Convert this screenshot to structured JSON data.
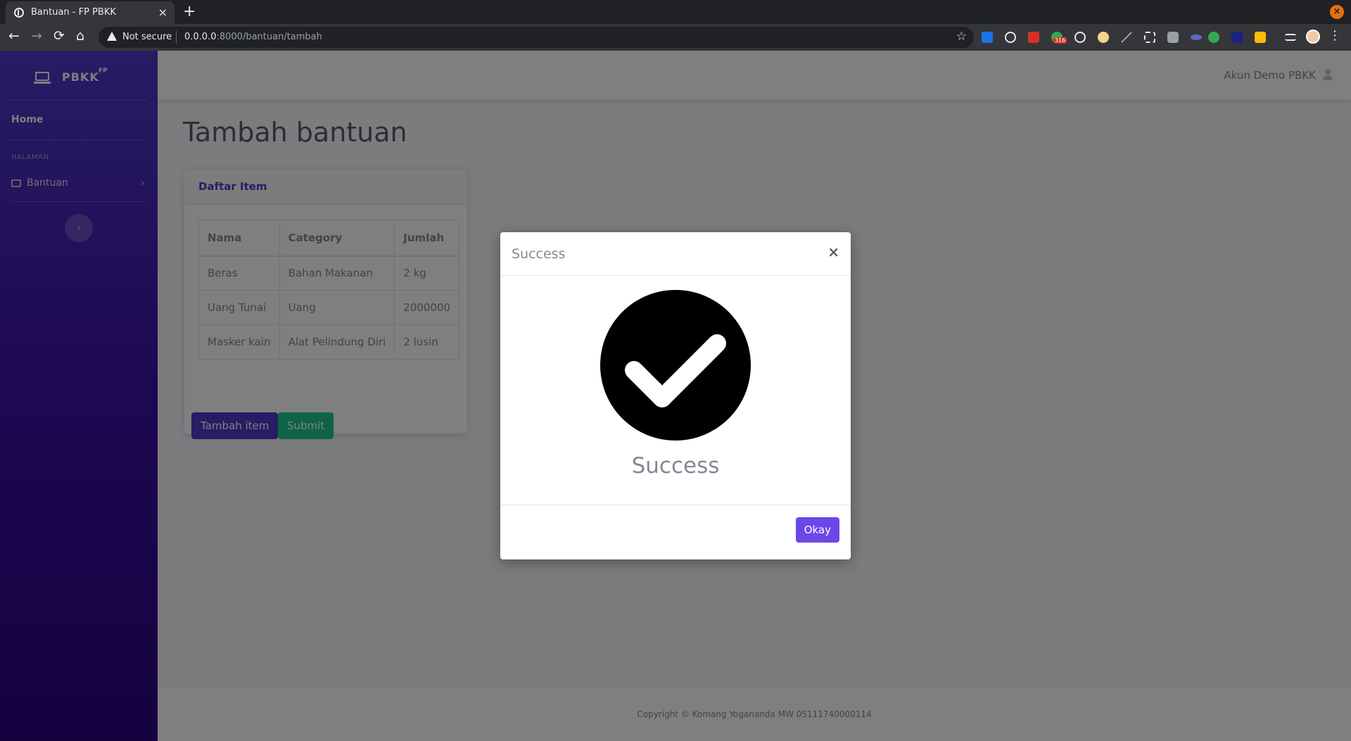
{
  "browser": {
    "tab_title": "Bantuan - FP PBKK",
    "tab_close": "×",
    "new_tab": "+",
    "win_close": "×",
    "security_label": "Not secure",
    "url_host": "0.0.0.0",
    "url_rest": ":8000/bantuan/tambah",
    "ext_badge": "316",
    "nav": {
      "back": "←",
      "forward": "→",
      "reload": "⟳",
      "home": "⌂"
    },
    "star": "☆",
    "menu": "⋮",
    "extension_icons": [
      "s-extension-icon",
      "react-devtools-icon",
      "red-extension-icon",
      "green-chat-icon",
      "globe-icon",
      "cookie-icon",
      "pen-icon",
      "crop-icon",
      "camera-icon",
      "php-icon",
      "color-icon",
      "terminal-icon",
      "note-icon",
      "playlist-icon"
    ]
  },
  "sidebar": {
    "brand": "PBKK",
    "brand_sup": "FP",
    "home": "Home",
    "heading": "HALAMAN",
    "item": "Bantuan",
    "chevron": "›",
    "toggle": "‹"
  },
  "topbar": {
    "user_name": "Akun Demo PBKK"
  },
  "page": {
    "title": "Tambah bantuan",
    "card_title": "Daftar Item",
    "table": {
      "headers": [
        "Nama",
        "Category",
        "Jumlah"
      ],
      "rows": [
        [
          "Beras",
          "Bahan Makanan",
          "2 kg"
        ],
        [
          "Uang Tunai",
          "Uang",
          "2000000"
        ],
        [
          "Masker kain",
          "Alat Pelindung Diri",
          "2 lusin"
        ]
      ]
    },
    "btn_add": "Tambah item",
    "btn_submit": "Submit"
  },
  "footer": {
    "copyright": "Copyright © Komang Yogananda MW 05111740000114"
  },
  "modal": {
    "title": "Success",
    "close": "×",
    "message": "Success",
    "okay": "Okay"
  },
  "colors": {
    "sidebar_top": "#4e3bc9",
    "sidebar_bottom": "#2b047f",
    "primary": "#4e3bc9",
    "success": "#1cc88a",
    "okay": "#6c47e8"
  }
}
